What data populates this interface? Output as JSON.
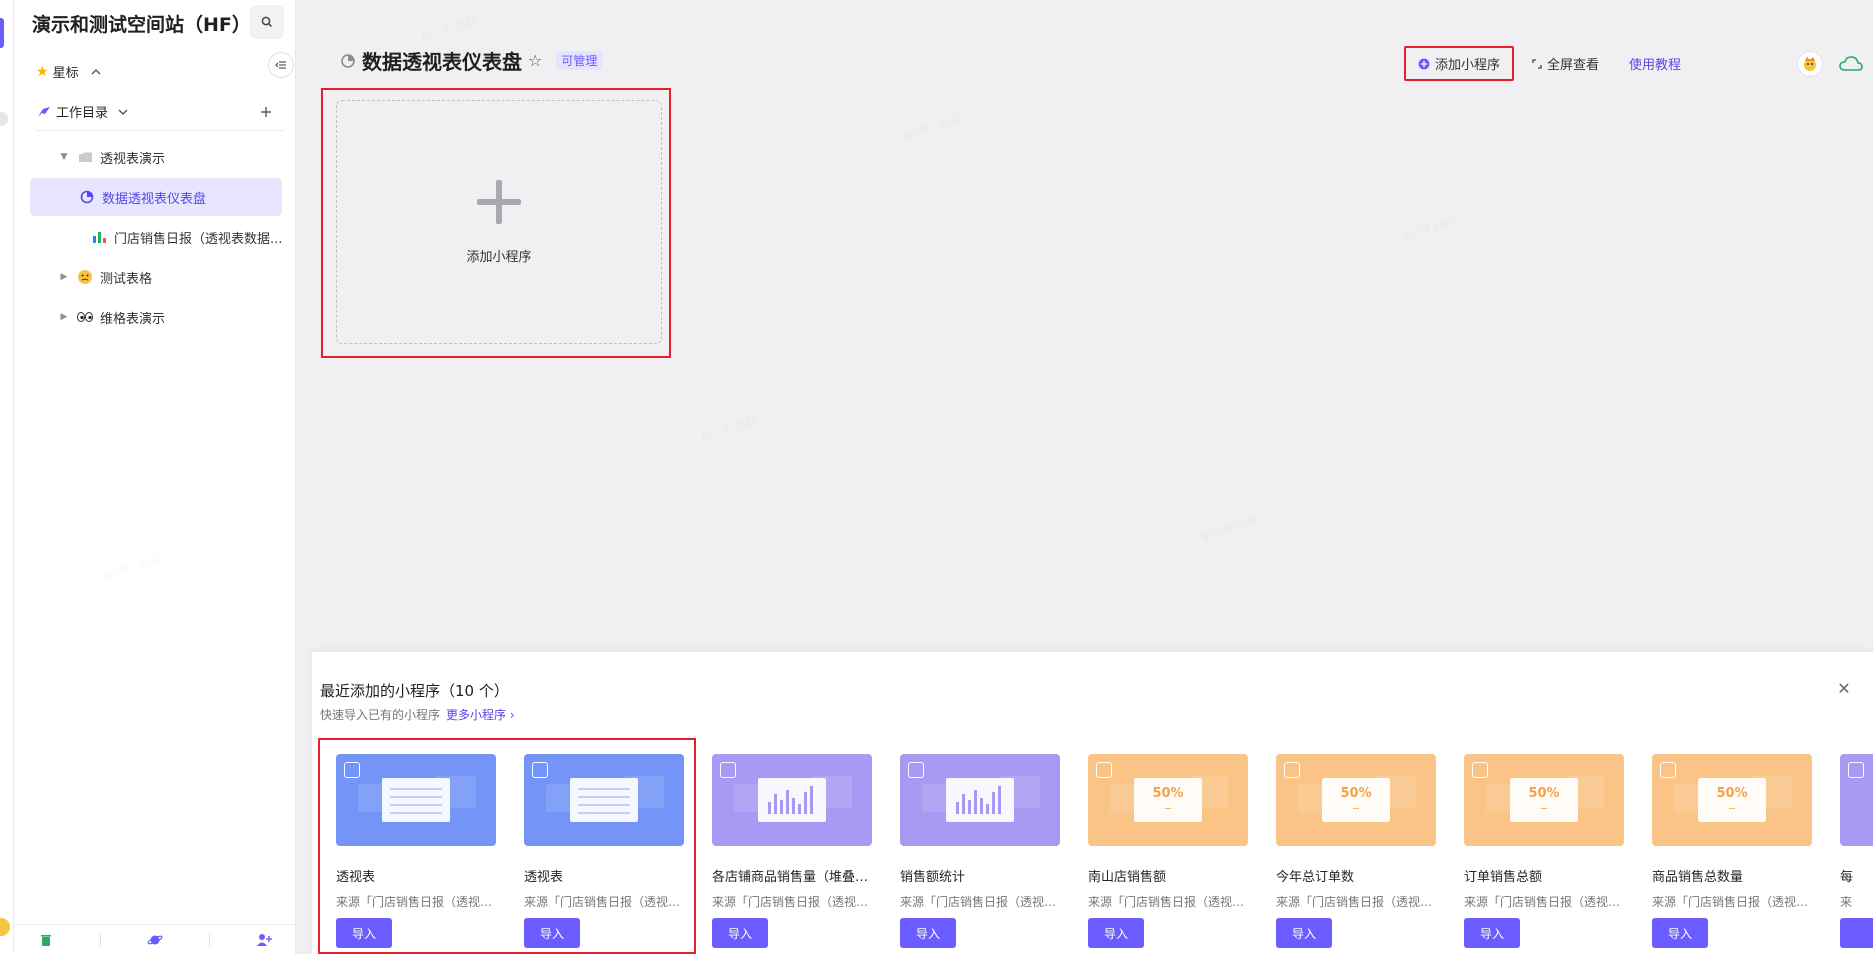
{
  "sidebar": {
    "space_title": "演示和测试空间站（HF）",
    "starred_label": "星标",
    "catalog_label": "工作目录",
    "tree": [
      {
        "label": "透视表演示",
        "icon": "folder-icon",
        "level": 1,
        "expanded": true
      },
      {
        "label": "数据透视表仪表盘",
        "icon": "dashboard-icon",
        "level": 2,
        "active": true
      },
      {
        "label": "门店销售日报（透视表数据...",
        "icon": "bar-chart-icon",
        "level": 2
      },
      {
        "label": "测试表格",
        "icon": "emoji-thinking-icon",
        "level": 1,
        "expanded": false
      },
      {
        "label": "维格表演示",
        "icon": "emoji-eyes-icon",
        "level": 1,
        "expanded": false
      }
    ],
    "footer_icons": [
      "trash-icon",
      "planet-icon",
      "invite-user-icon"
    ]
  },
  "dashboard": {
    "title": "数据透视表仪表盘",
    "badge": "可管理",
    "toolbar": {
      "add_widget": "添加小程序",
      "fullscreen": "全屏查看",
      "tutorial": "使用教程"
    },
    "empty_card_label": "添加小程序"
  },
  "drawer": {
    "title": "最近添加的小程序（10 个）",
    "subtitle": "快速导入已有的小程序",
    "more_link": "更多小程序",
    "import_label": "导入",
    "cards": [
      {
        "name": "透视表",
        "source": "来源「门店销售日报（透视表数据）」",
        "theme": "blue",
        "kind": "table"
      },
      {
        "name": "透视表",
        "source": "来源「门店销售日报（透视表数据）」",
        "theme": "blue",
        "kind": "table"
      },
      {
        "name": "各店铺商品销售量（堆叠柱状图）",
        "source": "来源「门店销售日报（透视表数据）」",
        "theme": "purple",
        "kind": "chart"
      },
      {
        "name": "销售额统计",
        "source": "来源「门店销售日报（透视表数据）」",
        "theme": "purple",
        "kind": "chart"
      },
      {
        "name": "南山店销售额",
        "source": "来源「门店销售日报（透视表数据）」",
        "theme": "orange",
        "kind": "stat",
        "percent": "50%"
      },
      {
        "name": "今年总订单数",
        "source": "来源「门店销售日报（透视表数据）」",
        "theme": "orange",
        "kind": "stat",
        "percent": "50%"
      },
      {
        "name": "订单销售总额",
        "source": "来源「门店销售日报（透视表数据）」",
        "theme": "orange",
        "kind": "stat",
        "percent": "50%"
      },
      {
        "name": "商品销售总数量",
        "source": "来源「门店销售日报（透视表数据）」",
        "theme": "orange",
        "kind": "stat",
        "percent": "50%"
      },
      {
        "name": "每",
        "source": "来",
        "theme": "purple",
        "kind": "chart"
      }
    ]
  },
  "watermark": "胡二峰 1886",
  "colors": {
    "accent": "#6b5cff",
    "highlight": "#e5202a",
    "active_bg": "#e8e5ff"
  }
}
